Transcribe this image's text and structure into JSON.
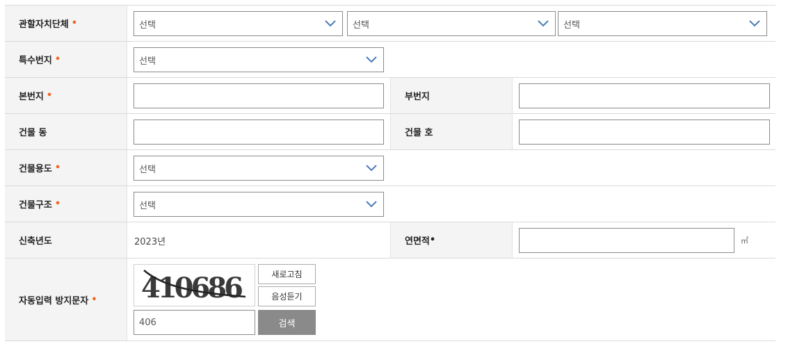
{
  "form": {
    "jurisdiction": {
      "label": "관할자치단체",
      "required": "•",
      "selects": [
        "선택",
        "선택",
        "선택"
      ]
    },
    "special_lot": {
      "label": "특수번지",
      "required": "•",
      "select": "선택"
    },
    "main_lot": {
      "label": "본번지",
      "required": "•",
      "value": ""
    },
    "sub_lot": {
      "label": "부번지",
      "value": ""
    },
    "building_dong": {
      "label": "건물 동",
      "value": ""
    },
    "building_ho": {
      "label": "건물 호",
      "value": ""
    },
    "building_use": {
      "label": "건물용도",
      "required": "•",
      "select": "선택"
    },
    "building_structure": {
      "label": "건물구조",
      "required": "•",
      "select": "선택"
    },
    "construction_year": {
      "label": "신축년도",
      "value": "2023년"
    },
    "floor_area": {
      "label": "연면적",
      "required": "•",
      "value": "",
      "unit": "㎡"
    },
    "captcha": {
      "label": "자동입력 방지문자",
      "required": "•",
      "image_text": "410686",
      "refresh_label": "새로고침",
      "audio_label": "음성듣기",
      "input_value": "406",
      "search_label": "검색"
    }
  },
  "colors": {
    "required": "#f26522",
    "chevron": "#4a7bb7",
    "header_bg": "#f4f4f4",
    "search_bg": "#8a8a8a"
  }
}
